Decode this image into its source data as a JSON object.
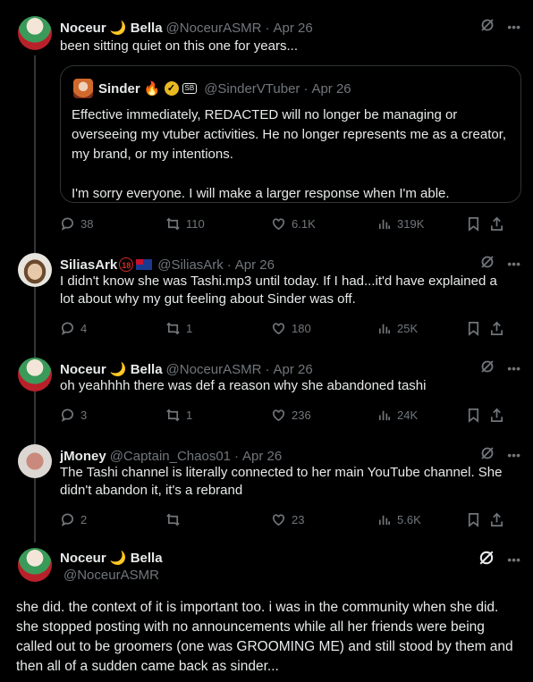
{
  "posts": [
    {
      "name": "Noceur 🌙 Bella",
      "handle": "@NoceurASMR",
      "date": "Apr 26",
      "text": "been sitting quiet on this one for years...",
      "quote": {
        "name": "Sinder 🔥",
        "badge": "✓",
        "tag": "SB",
        "handle": "@SinderVTuber",
        "date": "Apr 26",
        "text1": "Effective immediately, REDACTED will no longer be managing or overseeing my vtuber activities. He no longer represents me as a creator, my brand, or my intentions.",
        "text2": "I'm sorry everyone. I will make a larger response when I'm able."
      },
      "replies": "38",
      "reposts": "110",
      "likes": "6.1K",
      "views": "319K"
    },
    {
      "name": "SiliasArk",
      "age_badge": "18",
      "handle": "@SiliasArk",
      "date": "Apr 26",
      "text": "I didn't know she was Tashi.mp3 until today. If I had...it'd have explained a lot about why my gut feeling about Sinder was off.",
      "replies": "4",
      "reposts": "1",
      "likes": "180",
      "views": "25K"
    },
    {
      "name": "Noceur 🌙 Bella",
      "handle": "@NoceurASMR",
      "date": "Apr 26",
      "text": "oh yeahhhh there was def a reason why she abandoned tashi",
      "replies": "3",
      "reposts": "1",
      "likes": "236",
      "views": "24K"
    },
    {
      "name": "jMoney",
      "handle": "@Captain_Chaos01",
      "date": "Apr 26",
      "text": "The Tashi channel is literally connected to her main YouTube channel. She didn't abandon it, it's a rebrand",
      "replies": "2",
      "reposts": "",
      "likes": "23",
      "views": "5.6K"
    },
    {
      "name": "Noceur 🌙 Bella",
      "handle": "@NoceurASMR",
      "text": "she did. the context of it is important too. i was in the community when she did. she stopped posting with no announcements while all her friends were being called out to be groomers (one was GROOMING ME) and still stood by them and then all of a sudden came back as sinder..."
    }
  ],
  "icons": [
    "grok-icon",
    "more-icon",
    "reply-icon",
    "repost-icon",
    "like-icon",
    "views-icon",
    "bookmark-icon",
    "share-icon"
  ]
}
